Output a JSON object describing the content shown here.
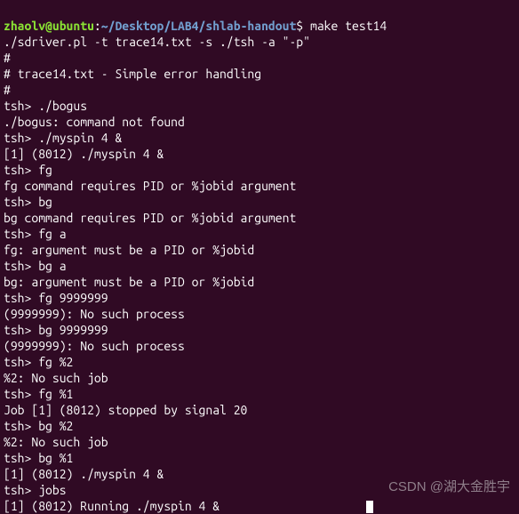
{
  "prompt": {
    "user": "zhaolv@ubuntu",
    "colon": ":",
    "path": "~/Desktop/LAB4/shlab-handout",
    "dollar": "$",
    "command": "make test14"
  },
  "lines": [
    "./sdriver.pl -t trace14.txt -s ./tsh -a \"-p\"",
    "#",
    "# trace14.txt - Simple error handling",
    "#",
    "tsh> ./bogus",
    "./bogus: command not found",
    "tsh> ./myspin 4 &",
    "[1] (8012) ./myspin 4 &",
    "tsh> fg",
    "fg command requires PID or %jobid argument",
    "tsh> bg",
    "bg command requires PID or %jobid argument",
    "tsh> fg a",
    "fg: argument must be a PID or %jobid",
    "tsh> bg a",
    "bg: argument must be a PID or %jobid",
    "tsh> fg 9999999",
    "(9999999): No such process",
    "tsh> bg 9999999",
    "(9999999): No such process",
    "tsh> fg %2",
    "%2: No such job",
    "tsh> fg %1",
    "Job [1] (8012) stopped by signal 20",
    "tsh> bg %2",
    "%2: No such job",
    "tsh> bg %1",
    "[1] (8012) ./myspin 4 &",
    "tsh> jobs",
    "[1] (8012) Running ./myspin 4 &"
  ],
  "watermark": "CSDN @湖大金胜宇"
}
